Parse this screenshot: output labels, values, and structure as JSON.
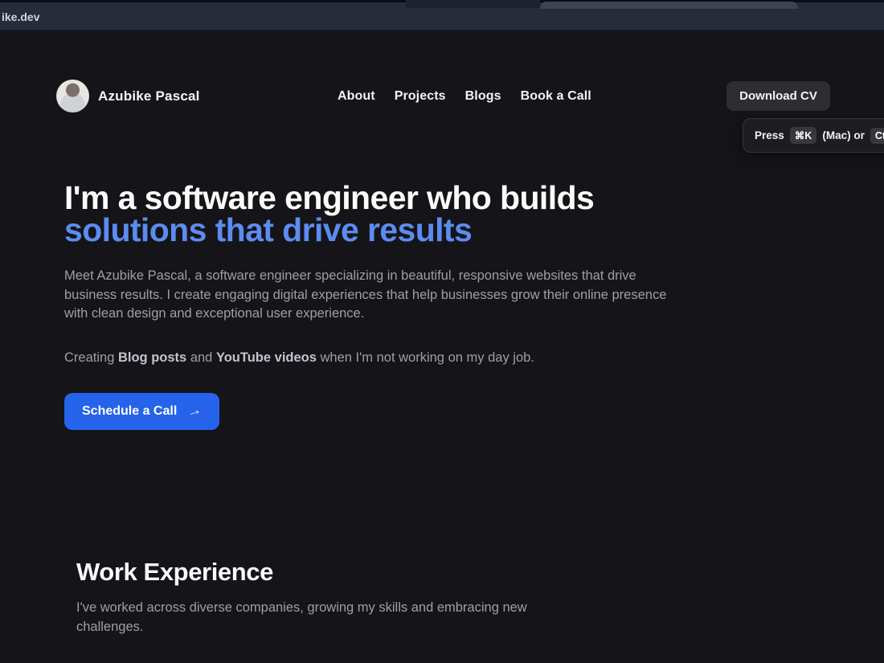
{
  "browser": {
    "url": "ike.dev"
  },
  "header": {
    "name": "Azubike Pascal",
    "nav": [
      "About",
      "Projects",
      "Blogs",
      "Book a Call"
    ],
    "download_cv_label": "Download CV"
  },
  "shortcut_toast": {
    "press": "Press",
    "key_mac": "⌘K",
    "middle": "(Mac) or",
    "key_win_partial": "Ct"
  },
  "hero": {
    "title_line1": "I'm a software engineer who builds",
    "title_line2": "solutions that drive results",
    "description": "Meet Azubike Pascal, a software engineer specializing in beautiful, responsive websites that drive business results. I create engaging digital experiences that help businesses grow their online presence with clean design and exceptional user experience.",
    "hobby_prefix": "Creating",
    "hobby_bold1": "Blog posts",
    "hobby_and": "and",
    "hobby_bold2": "YouTube videos",
    "hobby_suffix": "when I'm not working on my day job.",
    "cta_label": "Schedule a Call",
    "cta_arrow": "→"
  },
  "work": {
    "title": "Work Experience",
    "subtitle": "I've worked across diverse companies, growing my skills and embracing new challenges."
  },
  "colors": {
    "page_background": "#151418",
    "chrome_background": "#272c3b",
    "accent_blue": "#2563eb",
    "heading_accent_blue": "#5b8cf0",
    "body_text_gray": "#9aa0ab"
  }
}
